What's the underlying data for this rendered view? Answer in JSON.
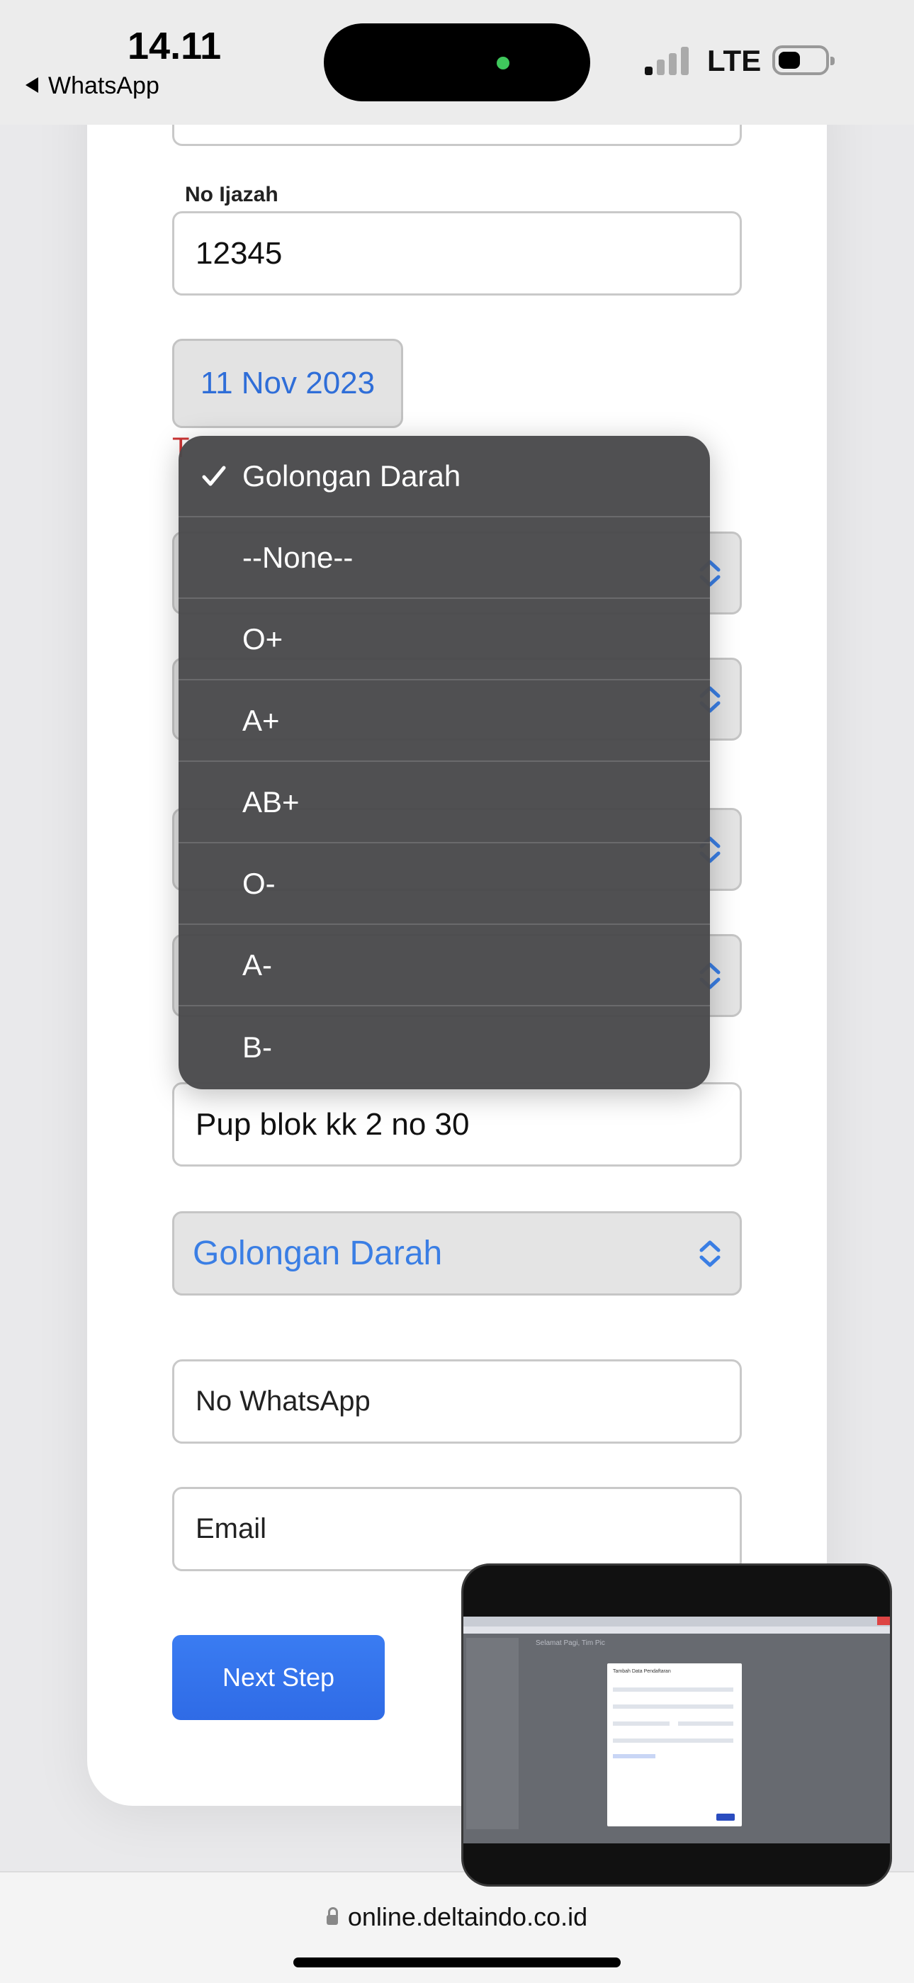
{
  "status_bar": {
    "time": "14.11",
    "back_app": "WhatsApp",
    "network": "LTE"
  },
  "form": {
    "ijazah_label": "No Ijazah",
    "ijazah_value": "12345",
    "date_value": "11 Nov 2023",
    "hidden_label_fragment": "T",
    "address_value": "Pup blok kk 2 no 30",
    "blood_select_value": "Golongan Darah",
    "whatsapp_placeholder": "No WhatsApp",
    "email_placeholder": "Email",
    "next_button": "Next Step"
  },
  "dropdown": {
    "options": [
      {
        "label": "Golongan Darah",
        "selected": true
      },
      {
        "label": "--None--",
        "selected": false
      },
      {
        "label": "O+",
        "selected": false
      },
      {
        "label": "A+",
        "selected": false
      },
      {
        "label": "AB+",
        "selected": false
      },
      {
        "label": "O-",
        "selected": false
      },
      {
        "label": "A-",
        "selected": false
      },
      {
        "label": "B-",
        "selected": false
      }
    ]
  },
  "browser": {
    "url": "online.deltaindo.co.id"
  },
  "pip": {
    "page_heading": "Selamat Pagi, Tim Pic",
    "modal_title": "Tambah Data Pendaftaran"
  },
  "colors": {
    "accent": "#2f6be6",
    "select_text": "#3a7ee4",
    "dropdown_bg": "#4a4a4c"
  }
}
